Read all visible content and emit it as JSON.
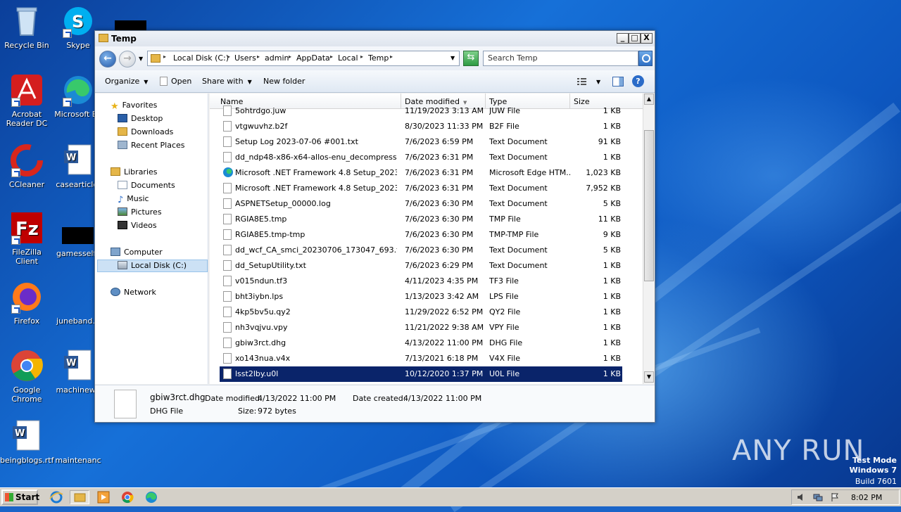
{
  "desktop": {
    "icons": [
      {
        "label": "Recycle Bin"
      },
      {
        "label": "Skype"
      },
      {
        "label": "Acrobat Reader DC"
      },
      {
        "label": "Microsoft Ed"
      },
      {
        "label": "CCleaner"
      },
      {
        "label": "casearticle."
      },
      {
        "label": "FileZilla Client"
      },
      {
        "label": "gamesself.j"
      },
      {
        "label": "Firefox"
      },
      {
        "label": "juneband.p"
      },
      {
        "label": "Google Chrome"
      },
      {
        "label": "machinewe"
      },
      {
        "label": "beingblogs.rtf"
      },
      {
        "label": "maintenanc"
      }
    ],
    "watermark": "ANY RUN",
    "test_mode": {
      "line1": "Test Mode",
      "line2": "Windows 7",
      "line3": "Build 7601"
    }
  },
  "window": {
    "title": "Temp",
    "controls": {
      "minimize": "_",
      "maximize": "□",
      "close": "X"
    },
    "breadcrumbs": [
      "Local Disk (C:)",
      "Users",
      "admin",
      "AppData",
      "Local",
      "Temp"
    ],
    "search_placeholder": "Search Temp",
    "toolbar": {
      "organize": "Organize",
      "open": "Open",
      "share_with": "Share with",
      "new_folder": "New folder"
    },
    "nav": {
      "favorites": "Favorites",
      "desktop": "Desktop",
      "downloads": "Downloads",
      "recent_places": "Recent Places",
      "libraries": "Libraries",
      "documents": "Documents",
      "music": "Music",
      "pictures": "Pictures",
      "videos": "Videos",
      "computer": "Computer",
      "local_disk": "Local Disk (C:)",
      "network": "Network"
    },
    "columns": {
      "name": "Name",
      "date_modified": "Date modified",
      "type": "Type",
      "size": "Size"
    },
    "files": [
      {
        "name": "5ohtrdgo.juw",
        "date": "11/19/2023 3:13 AM",
        "type": "JUW File",
        "size": "1 KB"
      },
      {
        "name": "vtgwuvhz.b2f",
        "date": "8/30/2023 11:33 PM",
        "type": "B2F File",
        "size": "1 KB"
      },
      {
        "name": "Setup Log 2023-07-06 #001.txt",
        "date": "7/6/2023 6:59 PM",
        "type": "Text Document",
        "size": "91 KB"
      },
      {
        "name": "dd_ndp48-x86-x64-allos-enu_decompression...",
        "date": "7/6/2023 6:31 PM",
        "type": "Text Document",
        "size": "1 KB"
      },
      {
        "name": "Microsoft .NET Framework 4.8 Setup_20230...",
        "date": "7/6/2023 6:31 PM",
        "type": "Microsoft Edge HTM...",
        "size": "1,023 KB"
      },
      {
        "name": "Microsoft .NET Framework 4.8 Setup_20230...",
        "date": "7/6/2023 6:31 PM",
        "type": "Text Document",
        "size": "7,952 KB"
      },
      {
        "name": "ASPNETSetup_00000.log",
        "date": "7/6/2023 6:30 PM",
        "type": "Text Document",
        "size": "5 KB"
      },
      {
        "name": "RGIA8E5.tmp",
        "date": "7/6/2023 6:30 PM",
        "type": "TMP File",
        "size": "11 KB"
      },
      {
        "name": "RGIA8E5.tmp-tmp",
        "date": "7/6/2023 6:30 PM",
        "type": "TMP-TMP File",
        "size": "9 KB"
      },
      {
        "name": "dd_wcf_CA_smci_20230706_173047_693.txt",
        "date": "7/6/2023 6:30 PM",
        "type": "Text Document",
        "size": "5 KB"
      },
      {
        "name": "dd_SetupUtility.txt",
        "date": "7/6/2023 6:29 PM",
        "type": "Text Document",
        "size": "1 KB"
      },
      {
        "name": "v015ndun.tf3",
        "date": "4/11/2023 4:35 PM",
        "type": "TF3 File",
        "size": "1 KB"
      },
      {
        "name": "bht3iybn.lps",
        "date": "1/13/2023 3:42 AM",
        "type": "LPS File",
        "size": "1 KB"
      },
      {
        "name": "4kp5bv5u.qy2",
        "date": "11/29/2022 6:52 PM",
        "type": "QY2 File",
        "size": "1 KB"
      },
      {
        "name": "nh3vqjvu.vpy",
        "date": "11/21/2022 9:38 AM",
        "type": "VPY File",
        "size": "1 KB"
      },
      {
        "name": "gbiw3rct.dhg",
        "date": "4/13/2022 11:00 PM",
        "type": "DHG File",
        "size": "1 KB"
      },
      {
        "name": "xo143nua.v4x",
        "date": "7/13/2021 6:18 PM",
        "type": "V4X File",
        "size": "1 KB"
      },
      {
        "name": "lsst2lby.u0l",
        "date": "10/12/2020 1:37 PM",
        "type": "U0L File",
        "size": "1 KB"
      }
    ],
    "details": {
      "filename": "gbiw3rct.dhg",
      "filetype": "DHG File",
      "date_modified_label": "Date modified:",
      "date_modified": "4/13/2022 11:00 PM",
      "date_created_label": "Date created:",
      "date_created": "4/13/2022 11:00 PM",
      "size_label": "Size:",
      "size": "972 bytes"
    }
  },
  "taskbar": {
    "start": "Start",
    "clock": "8:02 PM"
  }
}
